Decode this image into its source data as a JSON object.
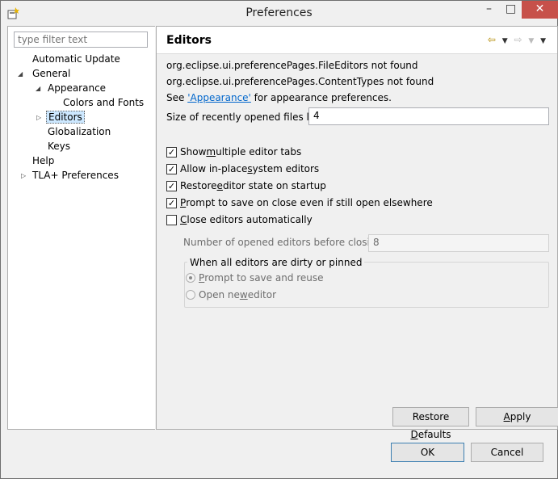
{
  "window": {
    "title": "Preferences"
  },
  "tree": {
    "filter_placeholder": "type filter text",
    "items": [
      {
        "label": "Automatic Update"
      },
      {
        "label": "General"
      },
      {
        "label": "Appearance"
      },
      {
        "label": "Colors and Fonts"
      },
      {
        "label": "Editors"
      },
      {
        "label": "Globalization"
      },
      {
        "label": "Keys"
      },
      {
        "label": "Help"
      },
      {
        "label": "TLA+ Preferences"
      }
    ]
  },
  "page": {
    "title": "Editors",
    "msg1": "org.eclipse.ui.preferencePages.FileEditors not found",
    "msg2": "org.eclipse.ui.preferencePages.ContentTypes not found",
    "see_prefix": "See ",
    "see_link": "'Appearance'",
    "see_suffix": " for appearance preferences.",
    "recent_label": "Size of recently opened files list:",
    "recent_value": "4",
    "checks": [
      {
        "pre": "Show ",
        "u": "m",
        "post": "ultiple editor tabs",
        "checked": true
      },
      {
        "pre": "Allow in-place ",
        "u": "s",
        "post": "ystem editors",
        "checked": true
      },
      {
        "pre": "Restore ",
        "u": "e",
        "post": "ditor state on startup",
        "checked": true
      },
      {
        "pre": "",
        "u": "P",
        "post": "rompt to save on close even if still open elsewhere",
        "checked": true
      },
      {
        "pre": "",
        "u": "C",
        "post": "lose editors automatically",
        "checked": false
      }
    ],
    "number_label": "Number of opened editors before closing:",
    "number_value": "8",
    "group_title": "When all editors are dirty or pinned",
    "radio1_pre": "",
    "radio1_u": "P",
    "radio1_post": "rompt to save and reuse",
    "radio2_pre": "Open ne",
    "radio2_u": "w",
    "radio2_post": " editor",
    "restore_pre": "Restore ",
    "restore_u": "D",
    "restore_post": "efaults",
    "apply_pre": "",
    "apply_u": "A",
    "apply_post": "pply"
  },
  "dialog": {
    "ok": "OK",
    "cancel": "Cancel"
  },
  "colors": {
    "accent": "#0066cc",
    "close": "#c7514a"
  }
}
